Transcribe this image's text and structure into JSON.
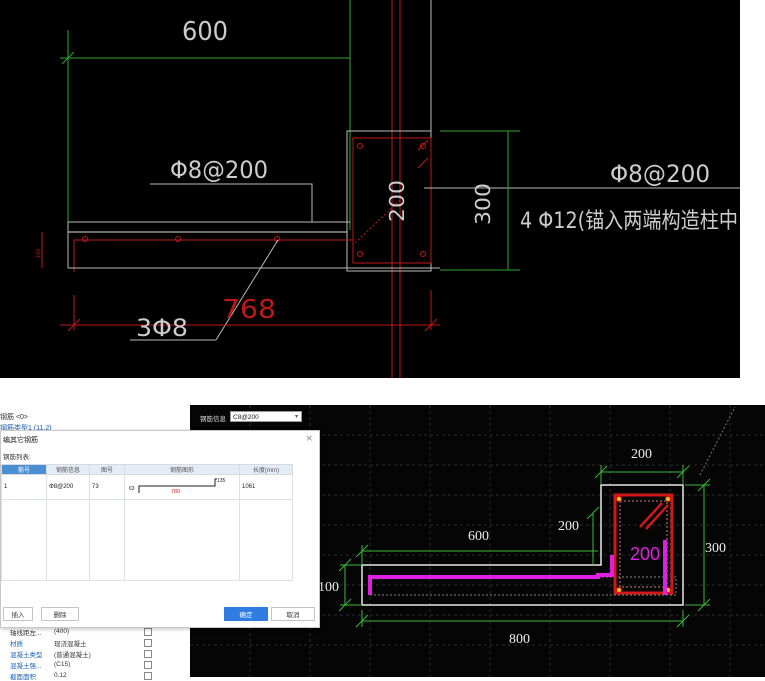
{
  "top_drawing": {
    "dim_600": "600",
    "stirrup_left": "Φ8@200",
    "dim_200": "200",
    "dim_300": "300",
    "stirrup_right": "Φ8@200",
    "long_bar": "4 Φ12(锚入两端构造柱中",
    "bottom_bars": "3Φ8",
    "dim_768": "768",
    "small_dim": "100"
  },
  "prop_panel": {
    "line1": "钢筋 <0>",
    "line2": "钢筋类型1 (11.2)",
    "rows": [
      {
        "name": "轴线距左...",
        "value": "(400)"
      },
      {
        "name": "材质",
        "value": "现浇混凝土"
      },
      {
        "name": "混凝土类型",
        "value": "(普通混凝土)"
      },
      {
        "name": "混凝土强...",
        "value": "(C15)"
      },
      {
        "name": "截面面积",
        "value": "0.12"
      }
    ]
  },
  "dialog": {
    "title": "编其它钢筋",
    "subtitle": "钢筋列表:",
    "close": "×",
    "columns": [
      "筋号",
      "钢筋信息",
      "图号",
      "钢筋图形",
      "长度(mm)"
    ],
    "row": {
      "no": "1",
      "info": "Φ8@200",
      "figure_no": "73",
      "shape_left": "63",
      "shape_mid": "780",
      "shape_right": "135",
      "length": "1061"
    },
    "btn_insert": "插入",
    "btn_delete": "删除",
    "btn_ok": "确定",
    "btn_cancel": "取消"
  },
  "cad_bottom": {
    "combo_label": "钢筋信息",
    "combo_value": "C8@200",
    "dim_200_top": "200",
    "dim_600": "600",
    "dim_200_mid": "200",
    "dim_200_pink": "200",
    "dim_300": "300",
    "dim_100": "100",
    "dim_800": "800"
  },
  "colors": {
    "cad_bg": "#000000",
    "dim_green": "#3cb93c",
    "rebar_red": "#d01818",
    "pink_bar": "#e020e0",
    "accent_blue": "#2f7de1"
  }
}
